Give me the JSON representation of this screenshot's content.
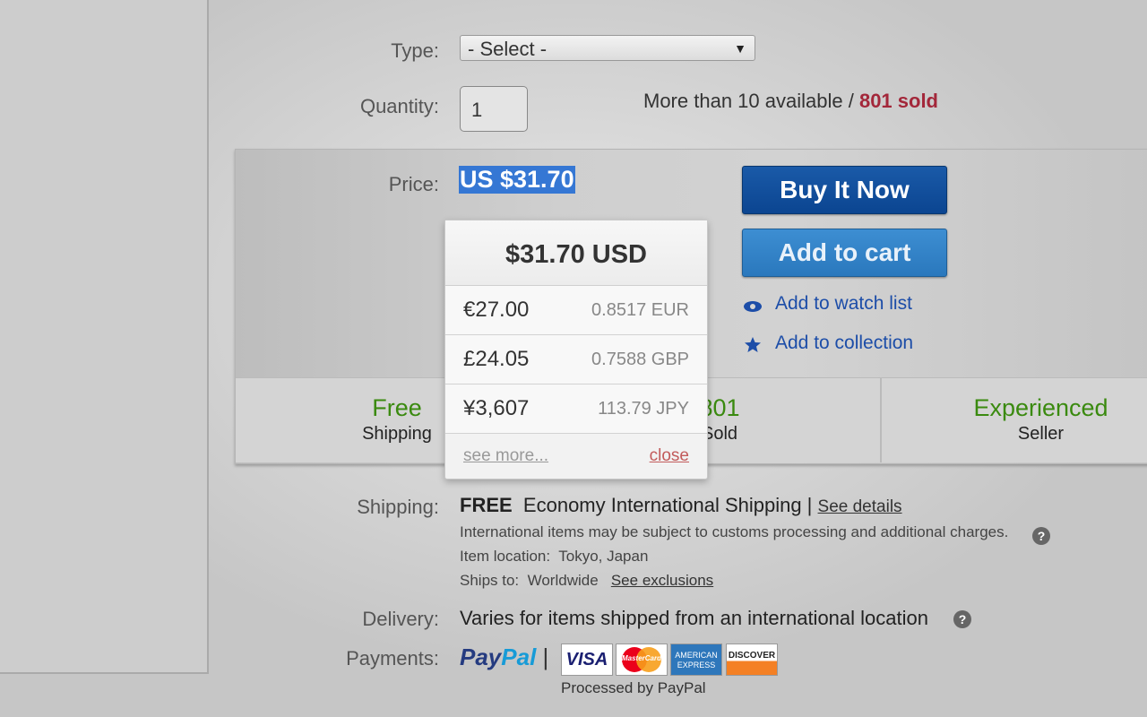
{
  "type": {
    "label": "Type:",
    "selected": "- Select -"
  },
  "quantity": {
    "label": "Quantity:",
    "value": "1",
    "available": "More than 10 available /",
    "sold": "801 sold"
  },
  "price": {
    "label": "Price:",
    "value": "US $31.70"
  },
  "actions": {
    "buy_now": "Buy It Now",
    "add_to_cart": "Add to cart",
    "watch": "Add to watch list",
    "collection": "Add to collection"
  },
  "stats": [
    {
      "big": "Free",
      "small": "Shipping"
    },
    {
      "big": "801",
      "small": "Sold"
    },
    {
      "big": "Experienced",
      "small": "Seller"
    }
  ],
  "currency_popup": {
    "title": "$31.70 USD",
    "rows": [
      {
        "amount": "€27.00",
        "rate": "0.8517 EUR"
      },
      {
        "amount": "£24.05",
        "rate": "0.7588 GBP"
      },
      {
        "amount": "¥3,607",
        "rate": "113.79 JPY"
      }
    ],
    "see_more": "see more...",
    "close": "close"
  },
  "shipping": {
    "label": "Shipping:",
    "free": "FREE",
    "method": "Economy International Shipping |",
    "details_link": "See details",
    "notice": "International items may be subject to customs processing and additional charges.",
    "location_label": "Item location:",
    "location": "Tokyo, Japan",
    "ships_to_label": "Ships to:",
    "ships_to": "Worldwide",
    "exclusions_link": "See exclusions"
  },
  "delivery": {
    "label": "Delivery:",
    "text": "Varies for items shipped from an international location"
  },
  "payments": {
    "label": "Payments:",
    "paypal_pay": "Pay",
    "paypal_pal": "Pal",
    "separator": "|",
    "processed": "Processed by PayPal",
    "cards": [
      "VISA",
      "MasterCard",
      "AMERICAN EXPRESS",
      "DISCOVER"
    ]
  },
  "colors": {
    "link": "#1c4da8",
    "sold": "#a3273a",
    "green": "#3a8a0f",
    "buy_button": "#0b4591",
    "cart_button": "#2a78bd",
    "price_highlight": "#3577d4"
  }
}
